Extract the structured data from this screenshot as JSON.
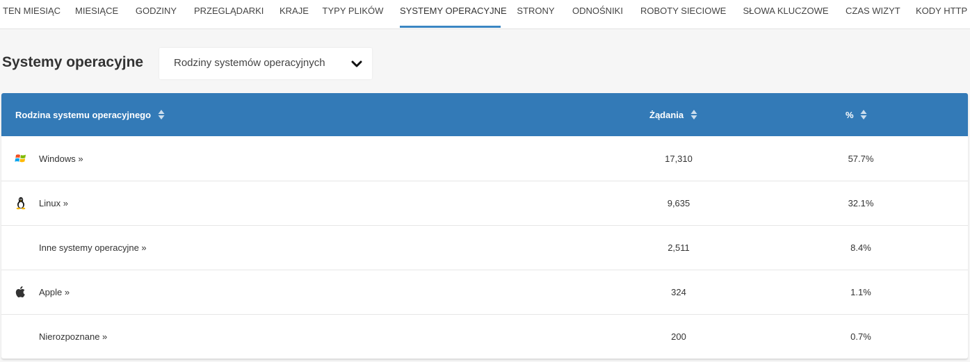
{
  "nav": {
    "tabs": [
      {
        "label": "TEN MIESIĄC"
      },
      {
        "label": "MIESIĄCE"
      },
      {
        "label": "GODZINY"
      },
      {
        "label": "PRZEGLĄDARKI"
      },
      {
        "label": "KRAJE"
      },
      {
        "label": "TYPY PLIKÓW"
      },
      {
        "label": "SYSTEMY OPERACYJNE",
        "active": true
      },
      {
        "label": "STRONY"
      },
      {
        "label": "ODNOŚNIKI"
      },
      {
        "label": "ROBOTY SIECIOWE"
      },
      {
        "label": "SŁOWA KLUCZOWE"
      },
      {
        "label": "CZAS WIZYT"
      },
      {
        "label": "KODY HTTP"
      }
    ]
  },
  "header": {
    "title": "Systemy operacyjne",
    "select_value": "Rodziny systemów operacyjnych",
    "select_icon": "chevron-down-icon"
  },
  "table": {
    "columns": {
      "family": "Rodzina systemu operacyjnego",
      "requests": "Żądania",
      "percent": "%"
    },
    "header_color": "#337ab7",
    "rows": [
      {
        "icon": "windows-icon",
        "name": "Windows »",
        "requests": "17,310",
        "percent": "57.7%"
      },
      {
        "icon": "linux-icon",
        "name": "Linux »",
        "requests": "9,635",
        "percent": "32.1%"
      },
      {
        "icon": "",
        "name": "Inne systemy operacyjne »",
        "requests": "2,511",
        "percent": "8.4%"
      },
      {
        "icon": "apple-icon",
        "name": "Apple »",
        "requests": "324",
        "percent": "1.1%"
      },
      {
        "icon": "",
        "name": "Nierozpoznane »",
        "requests": "200",
        "percent": "0.7%"
      }
    ]
  }
}
